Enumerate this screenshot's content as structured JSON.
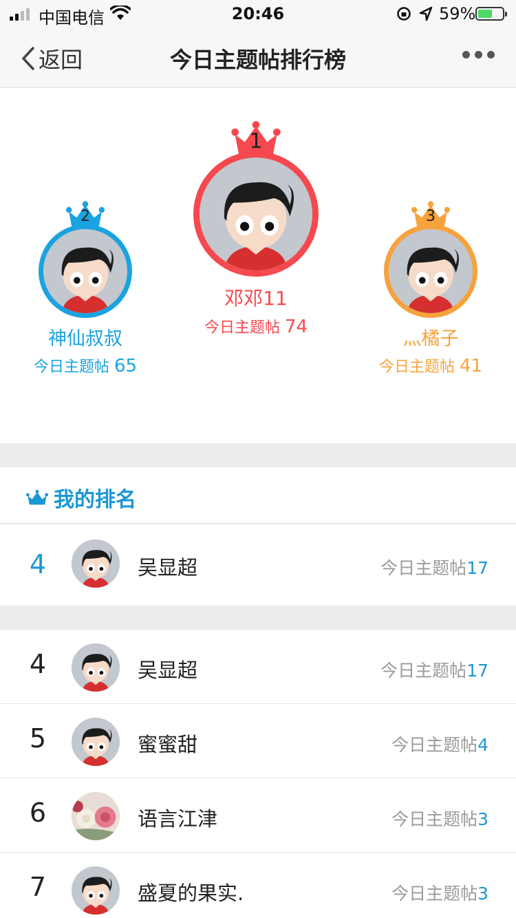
{
  "status_bar": {
    "carrier": "中国电信",
    "time": "20:46",
    "battery_percent": "59%",
    "battery_level": 0.59
  },
  "nav": {
    "back_label": "返回",
    "title": "今日主题帖排行榜"
  },
  "colors": {
    "first": "#f5494f",
    "second": "#1aa3e0",
    "third": "#f7a23c",
    "accent": "#1a97d5"
  },
  "podium": {
    "count_label": "今日主题帖",
    "first": {
      "rank": "1",
      "name": "邓邓11",
      "count": "74"
    },
    "second": {
      "rank": "2",
      "name": "神仙叔叔",
      "count": "65"
    },
    "third": {
      "rank": "3",
      "name": "灬橘子",
      "count": "41"
    }
  },
  "my_rank": {
    "title": "我的排名",
    "rank": "4",
    "name": "吴显超",
    "count_label": "今日主题帖",
    "count": "17"
  },
  "list": [
    {
      "rank": "4",
      "name": "吴显超",
      "count_label": "今日主题帖",
      "count": "17",
      "avatar": "cartoon-boy"
    },
    {
      "rank": "5",
      "name": "蜜蜜甜",
      "count_label": "今日主题帖",
      "count": "4",
      "avatar": "cartoon-boy"
    },
    {
      "rank": "6",
      "name": "语言江津",
      "count_label": "今日主题帖",
      "count": "3",
      "avatar": "roses-photo"
    },
    {
      "rank": "7",
      "name": "盛夏的果实.",
      "count_label": "今日主题帖",
      "count": "3",
      "avatar": "cartoon-boy"
    }
  ]
}
